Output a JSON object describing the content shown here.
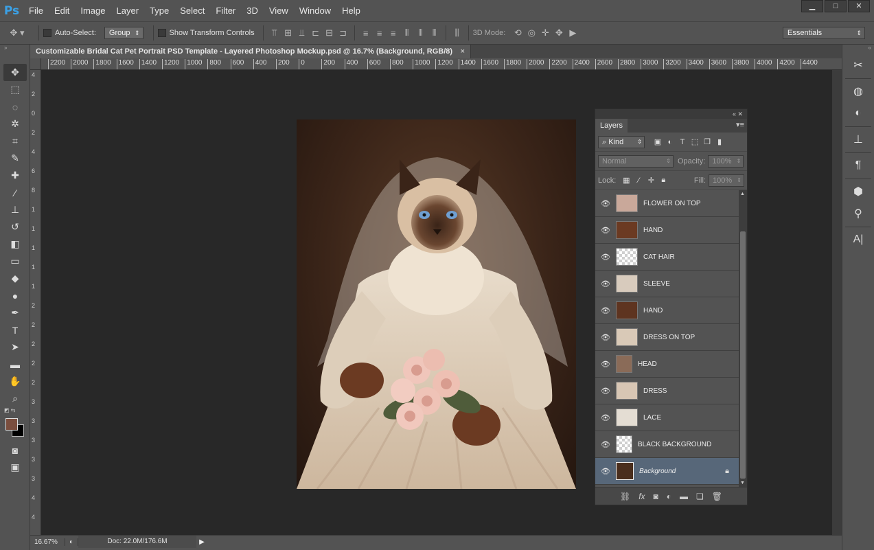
{
  "app": {
    "logo": "Ps"
  },
  "menu": [
    "File",
    "Edit",
    "Image",
    "Layer",
    "Type",
    "Select",
    "Filter",
    "3D",
    "View",
    "Window",
    "Help"
  ],
  "window_controls": [
    "▁",
    "□",
    "✕"
  ],
  "options": {
    "auto_select_label": "Auto-Select:",
    "auto_select_value": "Group",
    "show_transform_label": "Show Transform Controls",
    "mode_3d_label": "3D Mode:",
    "workspace": "Essentials"
  },
  "document": {
    "tab_title": "Customizable Bridal Cat Pet Portrait PSD Template - Layered Photoshop Mockup.psd @ 16.7% (Background, RGB/8)",
    "tab_close": "×",
    "zoom": "16.67%",
    "doc_size": "Doc: 22.0M/176.6M"
  },
  "ruler_h": [
    "2200",
    "2000",
    "1800",
    "1600",
    "1400",
    "1200",
    "1000",
    "800",
    "600",
    "400",
    "200",
    "0",
    "200",
    "400",
    "600",
    "800",
    "1000",
    "1200",
    "1400",
    "1600",
    "1800",
    "2000",
    "2200",
    "2400",
    "2600",
    "2800",
    "3000",
    "3200",
    "3400",
    "3600",
    "3800",
    "4000",
    "4200",
    "4400"
  ],
  "ruler_v": [
    "4",
    "2",
    "0",
    "2",
    "4",
    "6",
    "8",
    "1",
    "1",
    "1",
    "1",
    "1",
    "2",
    "2",
    "2",
    "2",
    "2",
    "3",
    "3",
    "3",
    "3",
    "3",
    "4",
    "4"
  ],
  "layers_panel": {
    "tab": "Layers",
    "kind_label": "Kind",
    "blend_mode": "Normal",
    "opacity_label": "Opacity:",
    "opacity_value": "100%",
    "lock_label": "Lock:",
    "fill_label": "Fill:",
    "fill_value": "100%",
    "layers": [
      {
        "name": "FLOWER ON TOP",
        "thumb": "#c9a89a"
      },
      {
        "name": "HAND",
        "thumb": "#6b3a22"
      },
      {
        "name": "CAT HAIR",
        "thumb": "checker"
      },
      {
        "name": "SLEEVE",
        "thumb": "#d8cbbd"
      },
      {
        "name": "HAND",
        "thumb": "#5e3420"
      },
      {
        "name": "DRESS ON TOP",
        "thumb": "#d9c9b7"
      },
      {
        "name": "HEAD",
        "thumb": "#8a6b58"
      },
      {
        "name": "DRESS",
        "thumb": "#d8c6b4"
      },
      {
        "name": "LACE",
        "thumb": "#e4ddd3"
      },
      {
        "name": "BLACK BACKGROUND",
        "thumb": "checker"
      },
      {
        "name": "Background",
        "thumb": "#4a2e1d",
        "selected": true
      }
    ]
  },
  "colors": {
    "foreground": "#7a4e3e",
    "background": "#000000",
    "ps_blue": "#3ba1e6",
    "selected_layer": "#576779"
  }
}
